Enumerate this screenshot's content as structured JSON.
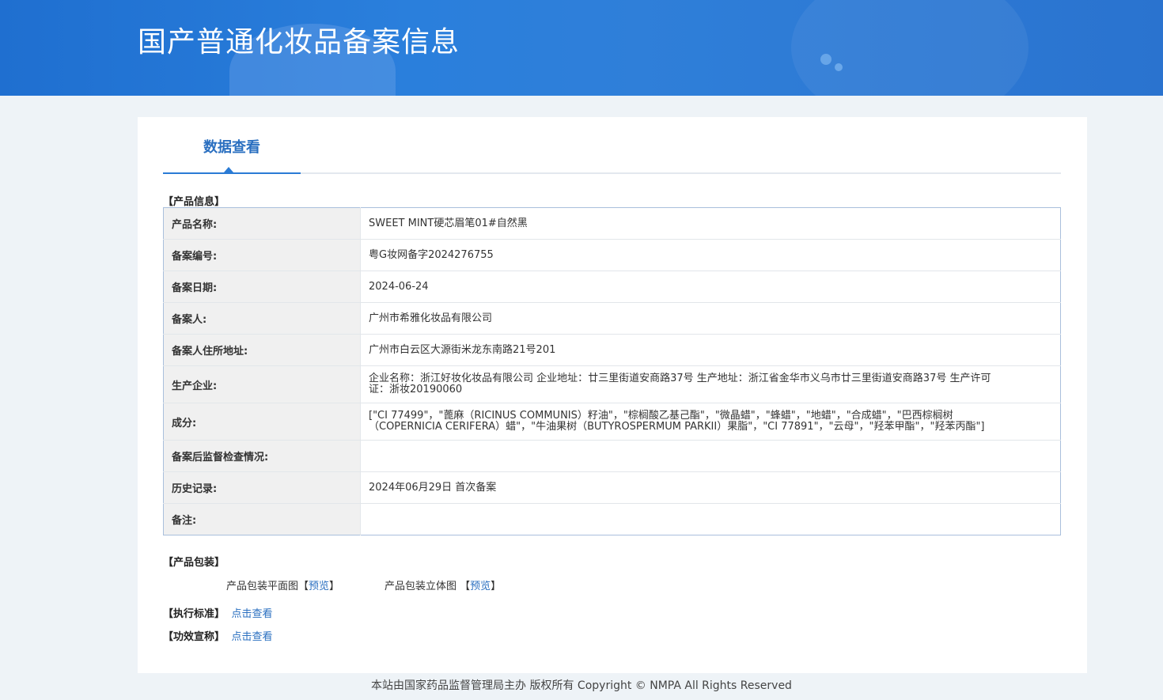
{
  "header": {
    "title": "国产普通化妆品备案信息"
  },
  "tabs": [
    {
      "label": "数据查看"
    }
  ],
  "product_info": {
    "section_label": "【产品信息】",
    "rows": [
      {
        "key": "产品名称:",
        "value": "SWEET MINT硬芯眉笔01#自然黑"
      },
      {
        "key": "备案编号:",
        "value": "粤G妆网备字2024276755"
      },
      {
        "key": "备案日期:",
        "value": "2024-06-24"
      },
      {
        "key": "备案人:",
        "value": "广州市希雅化妆品有限公司"
      },
      {
        "key": "备案人住所地址:",
        "value": "广州市白云区大源街米龙东南路21号201"
      },
      {
        "key": "生产企业:",
        "value": "企业名称：浙江好妆化妆品有限公司 企业地址：廿三里街道安商路37号 生产地址：浙江省金华市义乌市廿三里街道安商路37号 生产许可证：浙妆20190060"
      },
      {
        "key": "成分:",
        "value": "[\"CI 77499\"，\"蓖麻（RICINUS COMMUNIS）籽油\"，\"棕榈酸乙基己酯\"，\"微晶蜡\"，\"蜂蜡\"，\"地蜡\"，\"合成蜡\"，\"巴西棕榈树（COPERNICIA CERIFERA）蜡\"，\"牛油果树（BUTYROSPERMUM PARKII）果脂\"，\"CI 77891\"，\"云母\"，\"羟苯甲酯\"，\"羟苯丙酯\"]"
      },
      {
        "key": "备案后监督检查情况:",
        "value": ""
      },
      {
        "key": "历史记录:",
        "value": "2024年06月29日 首次备案"
      },
      {
        "key": "备注:",
        "value": ""
      }
    ]
  },
  "packaging": {
    "section_label": "【产品包装】",
    "flat_label": "产品包装平面图",
    "flat_bracket_open": "【",
    "flat_link": "预览",
    "flat_bracket_close": "】",
    "solid_label": "产品包装立体图 ",
    "solid_bracket_open": "【",
    "solid_link": "预览",
    "solid_bracket_close": "】"
  },
  "standard": {
    "label": "【执行标准】",
    "link": "点击查看"
  },
  "efficacy": {
    "label": "【功效宣称】",
    "link": "点击查看"
  },
  "footer": {
    "text": "本站由国家药品监督管理局主办 版权所有 Copyright © NMPA All Rights Reserved"
  }
}
